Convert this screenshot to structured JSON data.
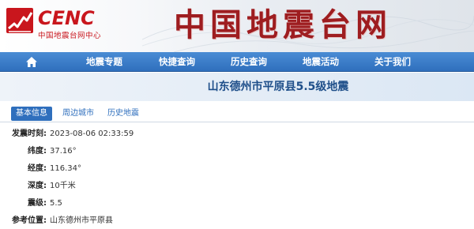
{
  "logo": {
    "brand": "CENC",
    "subtitle": "中国地震台网中心"
  },
  "site_title": "中国地震台网",
  "nav": {
    "home_icon": "home-icon",
    "items": [
      {
        "label": "地震专题"
      },
      {
        "label": "快捷查询"
      },
      {
        "label": "历史查询"
      },
      {
        "label": "地震活动"
      },
      {
        "label": "关于我们"
      }
    ]
  },
  "event_title": "山东德州市平原县5.5级地震",
  "tabs": [
    {
      "label": "基本信息",
      "active": true
    },
    {
      "label": "周边城市",
      "active": false
    },
    {
      "label": "历史地震",
      "active": false
    }
  ],
  "details": [
    {
      "label": "发震时刻:",
      "value": "2023-08-06 02:33:59"
    },
    {
      "label": "纬度:",
      "value": "37.16°"
    },
    {
      "label": "经度:",
      "value": "116.34°"
    },
    {
      "label": "深度:",
      "value": "10千米"
    },
    {
      "label": "震级:",
      "value": "5.5"
    },
    {
      "label": "参考位置:",
      "value": "山东德州市平原县"
    }
  ],
  "colors": {
    "brand_red": "#c9161d",
    "nav_blue": "#2f6fbd",
    "title_blue": "#1f4f8a"
  }
}
